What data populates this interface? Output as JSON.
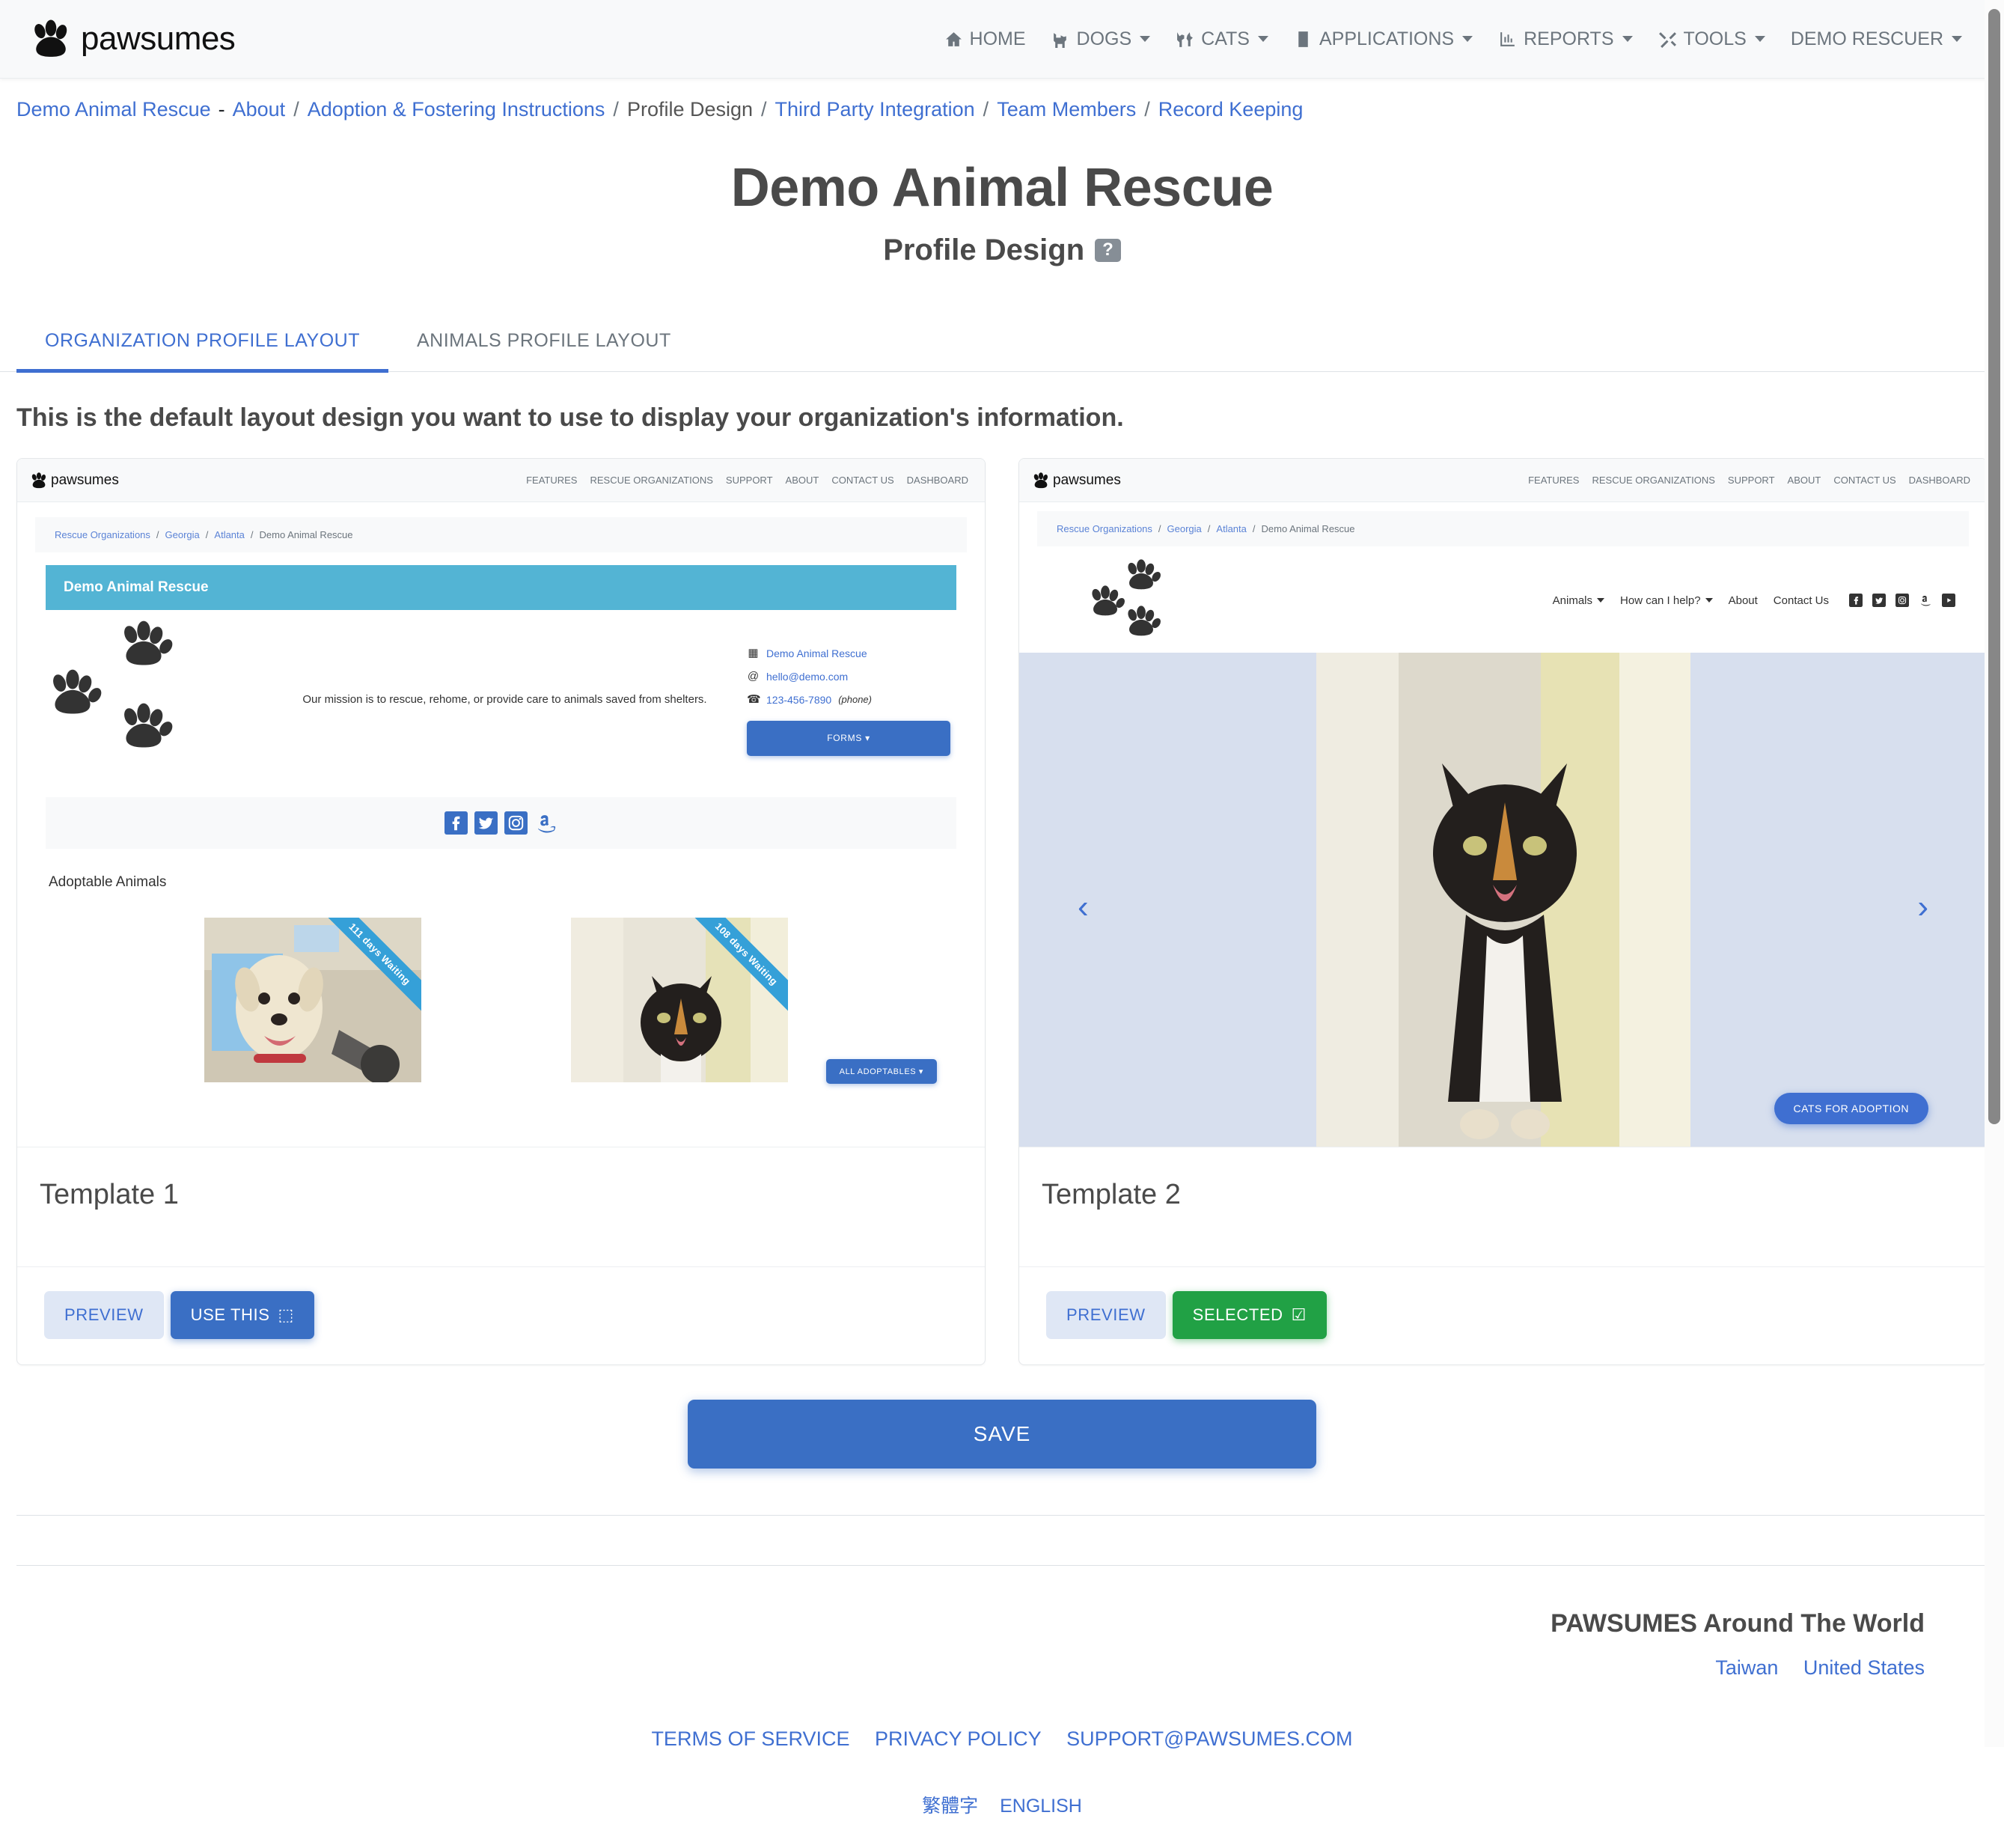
{
  "navbar": {
    "brand": "pawsumes",
    "links": [
      {
        "label": "HOME",
        "icon": "home-icon",
        "caret": false
      },
      {
        "label": "DOGS",
        "icon": "dog-icon",
        "caret": true
      },
      {
        "label": "CATS",
        "icon": "cat-icon",
        "caret": true
      },
      {
        "label": "APPLICATIONS",
        "icon": "clipboard-icon",
        "caret": true
      },
      {
        "label": "REPORTS",
        "icon": "chart-icon",
        "caret": true
      },
      {
        "label": "TOOLS",
        "icon": "tools-icon",
        "caret": true
      },
      {
        "label": "DEMO RESCUER",
        "icon": "",
        "caret": true
      }
    ]
  },
  "breadcrumb": {
    "org": "Demo Animal Rescue",
    "dash": "-",
    "items": [
      {
        "label": "About",
        "active": true
      },
      {
        "label": "Adoption & Fostering Instructions",
        "active": true
      },
      {
        "label": "Profile Design",
        "active": false
      },
      {
        "label": "Third Party Integration",
        "active": true
      },
      {
        "label": "Team Members",
        "active": true
      },
      {
        "label": "Record Keeping",
        "active": true
      }
    ],
    "separator": "/"
  },
  "header": {
    "title": "Demo Animal Rescue",
    "subtitle": "Profile Design",
    "help_badge": "?"
  },
  "tabs": [
    {
      "label": "ORGANIZATION PROFILE LAYOUT",
      "active": true
    },
    {
      "label": "ANIMALS PROFILE LAYOUT",
      "active": false
    }
  ],
  "intro_text": "This is the default layout design you want to use to display your organization's information.",
  "templates": [
    {
      "name": "Template 1",
      "preview_label": "PREVIEW",
      "action_label": "USE THIS",
      "action_glyph": "⬚",
      "state": "unselected"
    },
    {
      "name": "Template 2",
      "preview_label": "PREVIEW",
      "action_label": "SELECTED",
      "action_glyph": "☑",
      "state": "selected"
    }
  ],
  "mini_site": {
    "brand": "pawsumes",
    "nav_links": [
      "FEATURES",
      "RESCUE ORGANIZATIONS",
      "SUPPORT",
      "ABOUT",
      "CONTACT US",
      "DASHBOARD"
    ],
    "breadcrumb": [
      {
        "label": "Rescue Organizations",
        "link": true
      },
      {
        "label": "Georgia",
        "link": true
      },
      {
        "label": "Atlanta",
        "link": true
      },
      {
        "label": "Demo Animal Rescue",
        "link": false
      }
    ],
    "separator": "/"
  },
  "template1": {
    "hero_title": "Demo Animal Rescue",
    "mission": "Our mission is to rescue, rehome, or provide care to animals saved from shelters.",
    "contact": {
      "org_name": "Demo Animal Rescue",
      "email": "hello@demo.com",
      "phone": "123-456-7890",
      "phone_note": "(phone)"
    },
    "forms_button": "FORMS",
    "socials": [
      "facebook-icon",
      "twitter-icon",
      "instagram-icon",
      "amazon-icon"
    ],
    "section_title": "Adoptable Animals",
    "all_adoptables_button": "ALL ADOPTABLES",
    "animals": [
      {
        "ribbon": "111 days Waiting",
        "type": "dog"
      },
      {
        "ribbon": "108 days Waiting",
        "type": "cat"
      }
    ],
    "hero_bar_color": "#53b4d4"
  },
  "template2": {
    "menu": [
      {
        "label": "Animals",
        "caret": true
      },
      {
        "label": "How can I help?",
        "caret": true
      },
      {
        "label": "About",
        "caret": false
      },
      {
        "label": "Contact Us",
        "caret": false
      }
    ],
    "socials": [
      "facebook-icon",
      "twitter-icon",
      "instagram-icon",
      "amazon-icon",
      "youtube-icon"
    ],
    "prev_arrow": "‹",
    "next_arrow": "›",
    "cta_button": "CATS FOR ADOPTION",
    "carousel_bg": "#d7dfee"
  },
  "save_button": "SAVE",
  "footer": {
    "world_title": "PAWSUMES Around The World",
    "countries": [
      "Taiwan",
      "United States"
    ],
    "legal": [
      "TERMS OF SERVICE",
      "PRIVACY POLICY",
      "SUPPORT@PAWSUMES.COM"
    ],
    "languages": [
      "繁體字",
      "ENGLISH"
    ]
  },
  "colors": {
    "accent": "#3f6fd1",
    "success": "#21a145",
    "teal": "#53b4d4",
    "muted": "#6c757d"
  }
}
